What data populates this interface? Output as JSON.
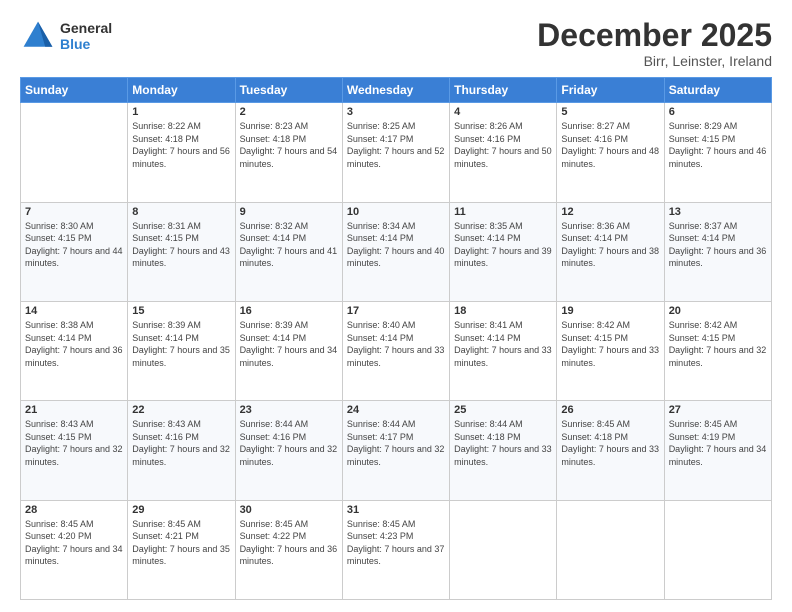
{
  "logo": {
    "general": "General",
    "blue": "Blue"
  },
  "header": {
    "month": "December 2025",
    "location": "Birr, Leinster, Ireland"
  },
  "weekdays": [
    "Sunday",
    "Monday",
    "Tuesday",
    "Wednesday",
    "Thursday",
    "Friday",
    "Saturday"
  ],
  "weeks": [
    [
      {
        "day": "",
        "sunrise": "",
        "sunset": "",
        "daylight": ""
      },
      {
        "day": "1",
        "sunrise": "8:22 AM",
        "sunset": "4:18 PM",
        "daylight": "7 hours and 56 minutes."
      },
      {
        "day": "2",
        "sunrise": "8:23 AM",
        "sunset": "4:18 PM",
        "daylight": "7 hours and 54 minutes."
      },
      {
        "day": "3",
        "sunrise": "8:25 AM",
        "sunset": "4:17 PM",
        "daylight": "7 hours and 52 minutes."
      },
      {
        "day": "4",
        "sunrise": "8:26 AM",
        "sunset": "4:16 PM",
        "daylight": "7 hours and 50 minutes."
      },
      {
        "day": "5",
        "sunrise": "8:27 AM",
        "sunset": "4:16 PM",
        "daylight": "7 hours and 48 minutes."
      },
      {
        "day": "6",
        "sunrise": "8:29 AM",
        "sunset": "4:15 PM",
        "daylight": "7 hours and 46 minutes."
      }
    ],
    [
      {
        "day": "7",
        "sunrise": "8:30 AM",
        "sunset": "4:15 PM",
        "daylight": "7 hours and 44 minutes."
      },
      {
        "day": "8",
        "sunrise": "8:31 AM",
        "sunset": "4:15 PM",
        "daylight": "7 hours and 43 minutes."
      },
      {
        "day": "9",
        "sunrise": "8:32 AM",
        "sunset": "4:14 PM",
        "daylight": "7 hours and 41 minutes."
      },
      {
        "day": "10",
        "sunrise": "8:34 AM",
        "sunset": "4:14 PM",
        "daylight": "7 hours and 40 minutes."
      },
      {
        "day": "11",
        "sunrise": "8:35 AM",
        "sunset": "4:14 PM",
        "daylight": "7 hours and 39 minutes."
      },
      {
        "day": "12",
        "sunrise": "8:36 AM",
        "sunset": "4:14 PM",
        "daylight": "7 hours and 38 minutes."
      },
      {
        "day": "13",
        "sunrise": "8:37 AM",
        "sunset": "4:14 PM",
        "daylight": "7 hours and 36 minutes."
      }
    ],
    [
      {
        "day": "14",
        "sunrise": "8:38 AM",
        "sunset": "4:14 PM",
        "daylight": "7 hours and 36 minutes."
      },
      {
        "day": "15",
        "sunrise": "8:39 AM",
        "sunset": "4:14 PM",
        "daylight": "7 hours and 35 minutes."
      },
      {
        "day": "16",
        "sunrise": "8:39 AM",
        "sunset": "4:14 PM",
        "daylight": "7 hours and 34 minutes."
      },
      {
        "day": "17",
        "sunrise": "8:40 AM",
        "sunset": "4:14 PM",
        "daylight": "7 hours and 33 minutes."
      },
      {
        "day": "18",
        "sunrise": "8:41 AM",
        "sunset": "4:14 PM",
        "daylight": "7 hours and 33 minutes."
      },
      {
        "day": "19",
        "sunrise": "8:42 AM",
        "sunset": "4:15 PM",
        "daylight": "7 hours and 33 minutes."
      },
      {
        "day": "20",
        "sunrise": "8:42 AM",
        "sunset": "4:15 PM",
        "daylight": "7 hours and 32 minutes."
      }
    ],
    [
      {
        "day": "21",
        "sunrise": "8:43 AM",
        "sunset": "4:15 PM",
        "daylight": "7 hours and 32 minutes."
      },
      {
        "day": "22",
        "sunrise": "8:43 AM",
        "sunset": "4:16 PM",
        "daylight": "7 hours and 32 minutes."
      },
      {
        "day": "23",
        "sunrise": "8:44 AM",
        "sunset": "4:16 PM",
        "daylight": "7 hours and 32 minutes."
      },
      {
        "day": "24",
        "sunrise": "8:44 AM",
        "sunset": "4:17 PM",
        "daylight": "7 hours and 32 minutes."
      },
      {
        "day": "25",
        "sunrise": "8:44 AM",
        "sunset": "4:18 PM",
        "daylight": "7 hours and 33 minutes."
      },
      {
        "day": "26",
        "sunrise": "8:45 AM",
        "sunset": "4:18 PM",
        "daylight": "7 hours and 33 minutes."
      },
      {
        "day": "27",
        "sunrise": "8:45 AM",
        "sunset": "4:19 PM",
        "daylight": "7 hours and 34 minutes."
      }
    ],
    [
      {
        "day": "28",
        "sunrise": "8:45 AM",
        "sunset": "4:20 PM",
        "daylight": "7 hours and 34 minutes."
      },
      {
        "day": "29",
        "sunrise": "8:45 AM",
        "sunset": "4:21 PM",
        "daylight": "7 hours and 35 minutes."
      },
      {
        "day": "30",
        "sunrise": "8:45 AM",
        "sunset": "4:22 PM",
        "daylight": "7 hours and 36 minutes."
      },
      {
        "day": "31",
        "sunrise": "8:45 AM",
        "sunset": "4:23 PM",
        "daylight": "7 hours and 37 minutes."
      },
      {
        "day": "",
        "sunrise": "",
        "sunset": "",
        "daylight": ""
      },
      {
        "day": "",
        "sunrise": "",
        "sunset": "",
        "daylight": ""
      },
      {
        "day": "",
        "sunrise": "",
        "sunset": "",
        "daylight": ""
      }
    ]
  ],
  "labels": {
    "sunrise_prefix": "Sunrise: ",
    "sunset_prefix": "Sunset: ",
    "daylight_prefix": "Daylight: "
  }
}
